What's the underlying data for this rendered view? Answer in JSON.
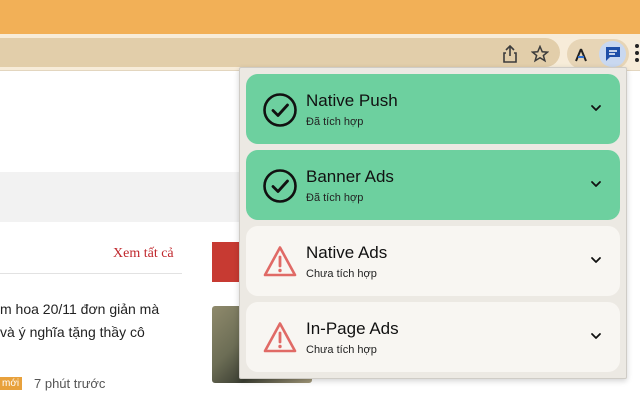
{
  "page": {
    "see_all": "Xem tất cả",
    "article_line_1": "m hoa 20/11 đơn giản mà",
    "article_line_2": "và ý nghĩa tặng thầy cô",
    "badge": "mới",
    "time": "7 phút trước"
  },
  "popup": {
    "items": [
      {
        "title": "Native Push",
        "status": "Đã tích hợp",
        "state": "integrated",
        "icon": "check-circle-icon"
      },
      {
        "title": "Banner Ads",
        "status": "Đã tích hợp",
        "state": "integrated",
        "icon": "check-circle-icon"
      },
      {
        "title": "Native Ads",
        "status": "Chưa tích hợp",
        "state": "not-integrated",
        "icon": "warning-icon"
      },
      {
        "title": "In-Page Ads",
        "status": "Chưa tích hợp",
        "state": "not-integrated",
        "icon": "warning-icon"
      }
    ]
  },
  "colors": {
    "integrated": "#6dd09f",
    "not_integrated": "#f8f6f2",
    "warning": "#e06a66",
    "accent_red": "#c0282d"
  },
  "toolbar": {
    "icons": [
      "share-icon",
      "bookmark-star-icon",
      "extension-icon",
      "chat-extension-icon",
      "more-icon"
    ]
  }
}
